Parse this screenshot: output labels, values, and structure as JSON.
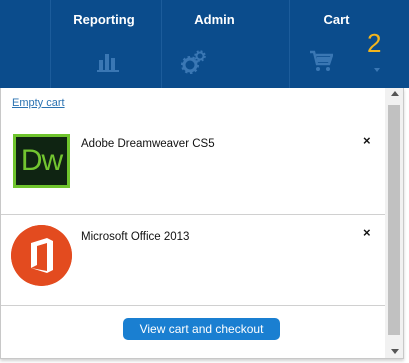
{
  "nav": {
    "items": [
      {
        "label": "Reporting",
        "icon": "bar-chart-icon"
      },
      {
        "label": "Admin",
        "icon": "gears-icon"
      },
      {
        "label": "Cart",
        "icon": "shopping-cart-icon"
      }
    ],
    "cart_count": "2"
  },
  "cart": {
    "empty_link": "Empty cart",
    "items": [
      {
        "name": "Adobe Dreamweaver CS5",
        "logo_text": "Dw",
        "remove": "×"
      },
      {
        "name": "Microsoft Office 2013",
        "remove": "×"
      }
    ],
    "checkout_label": "View cart and checkout"
  },
  "colors": {
    "navbar": "#0b4c8c",
    "cart_count": "#f3b51d",
    "button": "#1a7fd1",
    "link": "#2b73b2"
  }
}
